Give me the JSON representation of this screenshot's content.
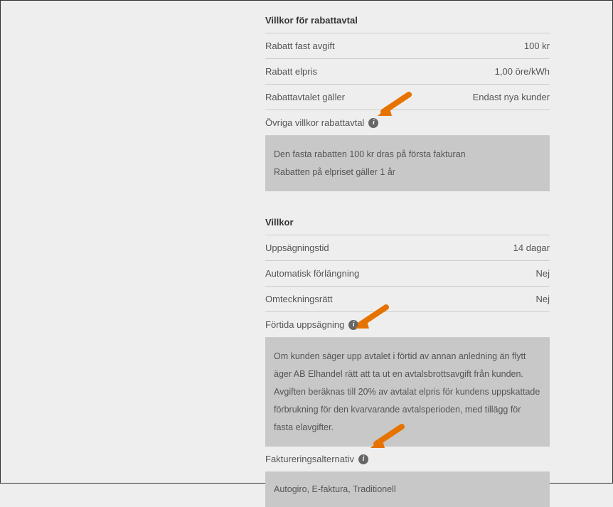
{
  "section1": {
    "title": "Villkor för rabattavtal",
    "rows": [
      {
        "label": "Rabatt fast avgift",
        "value": "100 kr"
      },
      {
        "label": "Rabatt elpris",
        "value": "1,00 öre/kWh"
      },
      {
        "label": "Rabattavtalet gäller",
        "value": "Endast nya kunder"
      }
    ],
    "info_label": "Övriga villkor rabattavtal",
    "info_text_line1": "Den fasta rabatten 100 kr dras på första fakturan",
    "info_text_line2": "Rabatten på elpriset gäller 1 år"
  },
  "section2": {
    "title": "Villkor",
    "rows": [
      {
        "label": "Uppsägningstid",
        "value": "14 dagar"
      },
      {
        "label": "Automatisk förlängning",
        "value": "Nej"
      },
      {
        "label": "Omteckningsrätt",
        "value": "Nej"
      }
    ],
    "info1_label": "Förtida uppsägning",
    "info1_text": "Om kunden säger upp avtalet i förtid av annan anledning än flytt äger AB Elhandel rätt att ta ut en avtalsbrottsavgift från kunden. Avgiften beräknas till 20% av avtalat elpris för kundens uppskattade förbrukning för den kvarvarande avtalsperioden, med tillägg för fasta elavgifter.",
    "info2_label": "Faktureringsalternativ",
    "info2_text": "Autogiro, E-faktura, Traditionell"
  }
}
